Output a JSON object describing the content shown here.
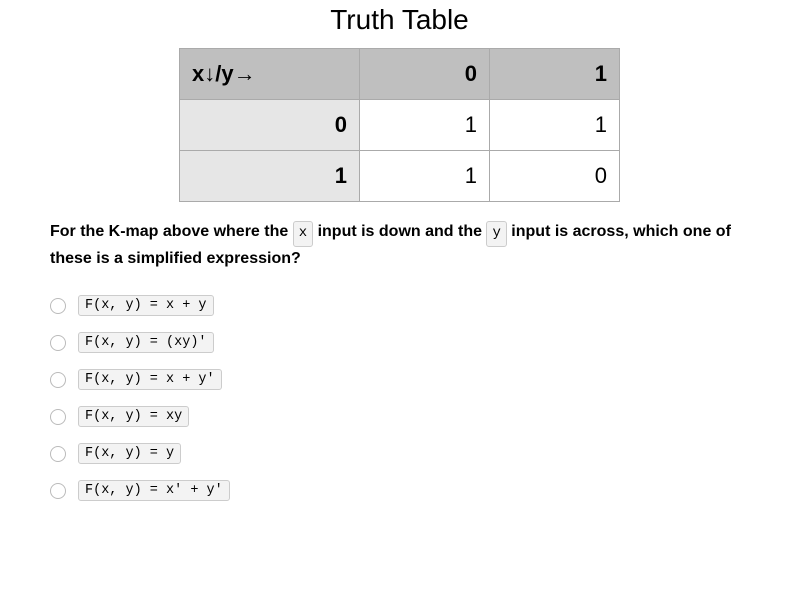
{
  "title": "Truth Table",
  "table": {
    "corner": "x↓/y→",
    "col_heads": [
      "0",
      "1"
    ],
    "rows": [
      {
        "head": "0",
        "cells": [
          "1",
          "1"
        ]
      },
      {
        "head": "1",
        "cells": [
          "1",
          "0"
        ]
      }
    ]
  },
  "question": {
    "part1": "For the K-map above where the ",
    "chip1": "x",
    "part2": " input is down and the ",
    "chip2": "y",
    "part3": " input is across, which one of these is a simplified expression?"
  },
  "options": [
    "F(x, y) = x + y",
    "F(x, y) = (xy)'",
    "F(x, y) = x + y'",
    "F(x, y) = xy",
    "F(x, y) = y",
    "F(x, y) = x' + y'"
  ],
  "chart_data": {
    "type": "table",
    "title": "Truth Table",
    "columns": [
      "x",
      "y=0",
      "y=1"
    ],
    "rows": [
      [
        "0",
        1,
        1
      ],
      [
        "1",
        1,
        0
      ]
    ]
  }
}
